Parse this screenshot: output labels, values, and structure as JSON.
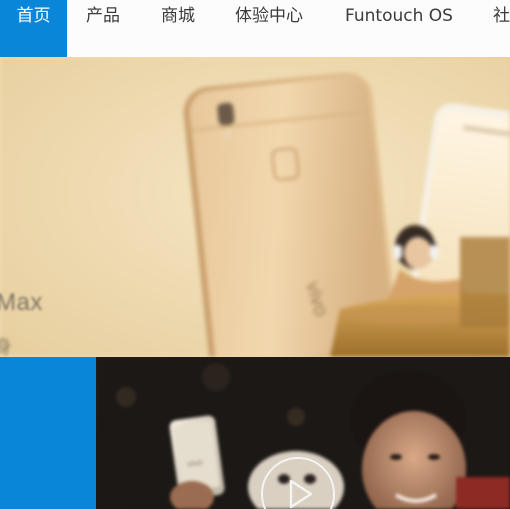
{
  "nav": {
    "items": [
      {
        "label": "首页",
        "active": true
      },
      {
        "label": "产品",
        "active": false
      },
      {
        "label": "商城",
        "active": false
      },
      {
        "label": "体验中心",
        "active": false
      },
      {
        "label": "Funtouch OS",
        "active": false
      },
      {
        "label": "社",
        "active": false
      }
    ]
  },
  "hero": {
    "caption": "Max",
    "caption_sub": "身"
  },
  "video": {
    "play_icon": "play-icon"
  },
  "colors": {
    "accent": "#0a86d8",
    "nav_bg": "#fcfcfc",
    "nav_text": "#3b3b3b",
    "hero_bg": "#f0dcb3",
    "video_bg": "#1d1917"
  }
}
